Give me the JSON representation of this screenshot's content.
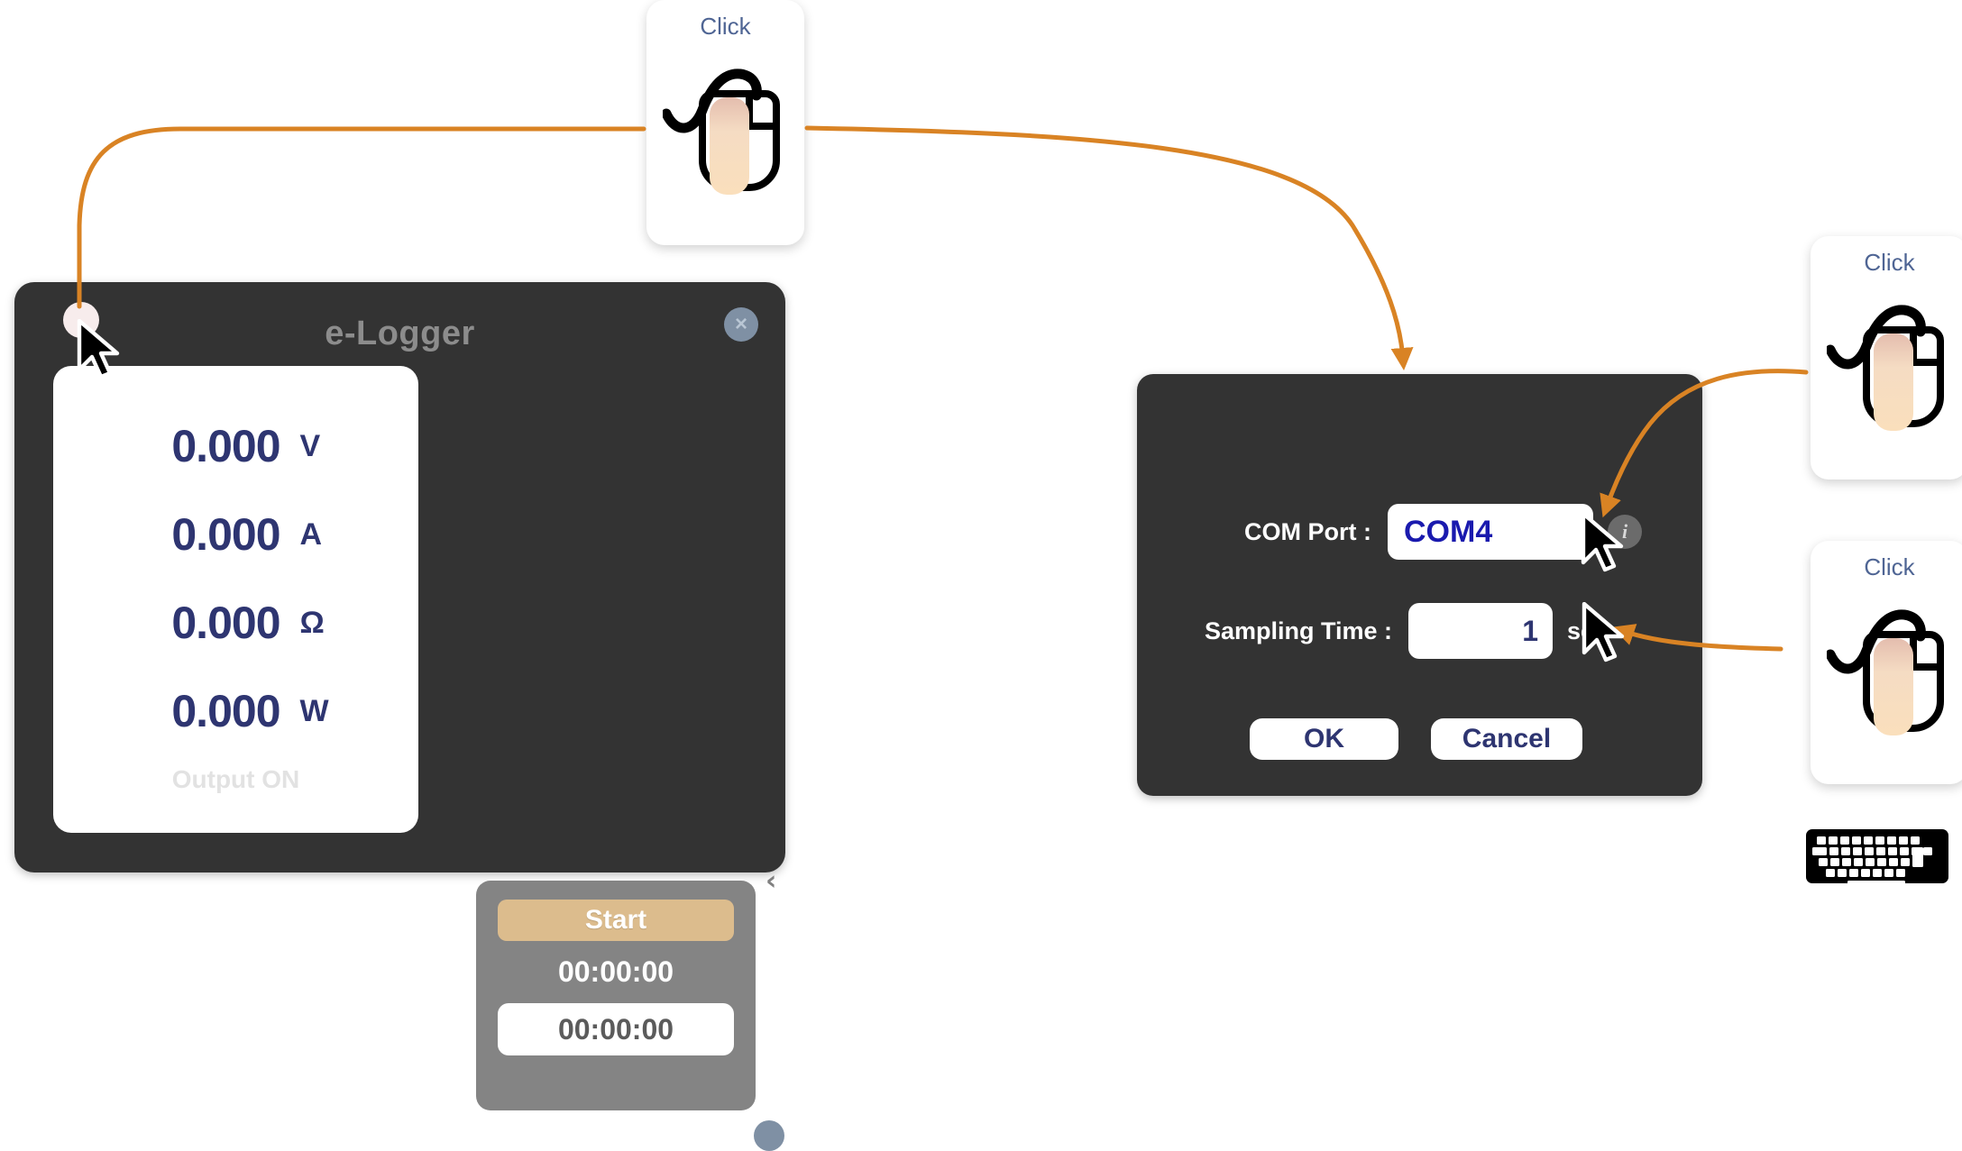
{
  "elogger": {
    "title": "e-Logger",
    "close_label": "×",
    "menu_dot_name": "menu-dot",
    "readings": [
      {
        "value": "0.000",
        "unit": "V"
      },
      {
        "value": "0.000",
        "unit": "A"
      },
      {
        "value": "0.000",
        "unit": "Ω"
      },
      {
        "value": "0.000",
        "unit": "W"
      }
    ],
    "output_status": "Output ON",
    "timer": {
      "start_label": "Start",
      "elapsed": "00:00:00",
      "target": "00:00:00"
    },
    "collapse_chevron": "‹"
  },
  "settings_dialog": {
    "com_port_label": "COM Port :",
    "com_port_value": "COM4",
    "info_badge": "i",
    "sampling_time_label": "Sampling Time :",
    "sampling_time_value": "1",
    "sampling_time_unit": "sec",
    "ok_label": "OK",
    "cancel_label": "Cancel"
  },
  "callouts": [
    {
      "label": "Click"
    },
    {
      "label": "Click"
    },
    {
      "label": "Click"
    }
  ],
  "colors": {
    "window_bg": "#333333",
    "accent_orange": "#d98324",
    "reading_navy": "#2e3571",
    "com_blue": "#1a1aae",
    "start_tan": "#dcbc8d",
    "click_label_blue": "#4f6594"
  }
}
